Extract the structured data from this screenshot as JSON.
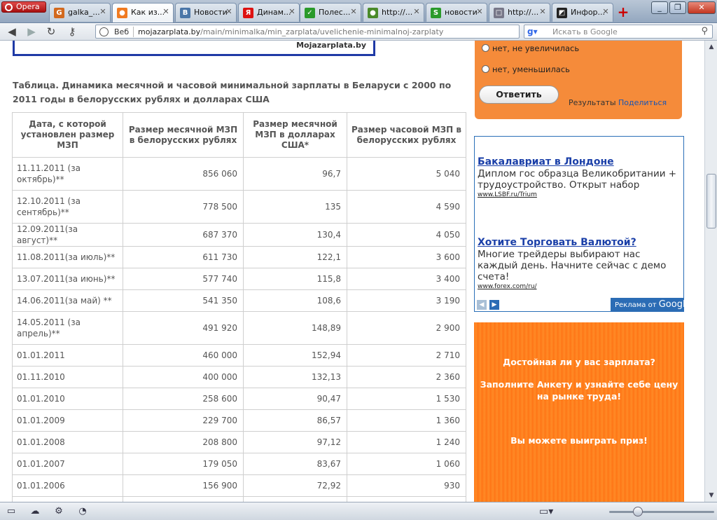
{
  "browser": {
    "menu_label": "Opera",
    "tabs": [
      {
        "label": "galka_...",
        "fav": "G",
        "color": "#d2691e"
      },
      {
        "label": "Как из...",
        "fav": "●",
        "color": "#f07a20",
        "active": true
      },
      {
        "label": "Новости",
        "fav": "B",
        "color": "#4a76a8"
      },
      {
        "label": "Динам...",
        "fav": "Я",
        "color": "#d11"
      },
      {
        "label": "Полес...",
        "fav": "✓",
        "color": "#2a9a2a"
      },
      {
        "label": "http://...",
        "fav": "●",
        "color": "#4a8a2a"
      },
      {
        "label": "новости",
        "fav": "S",
        "color": "#2a9a2a"
      },
      {
        "label": "http://...",
        "fav": "□",
        "color": "#778"
      },
      {
        "label": "Инфор...",
        "fav": "◩",
        "color": "#222"
      }
    ],
    "address": {
      "scheme_label": "Веб",
      "domain": "mojazarplata.by",
      "path": "/main/minimalka/min_zarplata/uvelichenie-minimalnoj-zarplaty"
    },
    "search_placeholder": "Искать в Google"
  },
  "page": {
    "banner_text": "Mojazarplata.by",
    "caption": "Таблица. Динамика месячной и часовой минимальной зарплаты в Беларуси с 2000 по 2011 годы в белорусских рублях и долларах США",
    "table": {
      "headers": [
        "Дата, с которой установлен размер МЗП",
        "Размер месячной МЗП в белорусских рублях",
        "Размер месячной МЗП в долларах США*",
        "Размер часовой МЗП в белорусских рублях"
      ],
      "rows": [
        [
          "11.11.2011 (за октябрь)**",
          "856 060",
          "96,7",
          "5 040"
        ],
        [
          "12.10.2011 (за сентябрь)**",
          "778 500",
          "135",
          "4 590"
        ],
        [
          "12.09.2011(за август)**",
          "687 370",
          "130,4",
          "4 050"
        ],
        [
          "11.08.2011(за июль)**",
          "611 730",
          "122,1",
          "3 600"
        ],
        [
          "13.07.2011(за июнь)**",
          "577 740",
          "115,8",
          "3 400"
        ],
        [
          "14.06.2011(за май) **",
          "541 350",
          "108,6",
          "3 190"
        ],
        [
          "14.05.2011 (за апрель)**",
          "491 920",
          "148,89",
          "2 900"
        ],
        [
          "01.01.2011",
          "460 000",
          "152,94",
          "2 710"
        ],
        [
          "01.11.2010",
          "400 000",
          "132,13",
          "2 360"
        ],
        [
          "01.01.2010",
          "258 600",
          "90,47",
          "1 530"
        ],
        [
          "01.01.2009",
          "229 700",
          "86,57",
          "1 360"
        ],
        [
          "01.01.2008",
          "208 800",
          "97,12",
          "1 240"
        ],
        [
          "01.01.2007",
          "179 050",
          "83,67",
          "1 060"
        ],
        [
          "01.01.2006",
          "156 900",
          "72,92",
          "930"
        ],
        [
          "",
          "",
          "",
          ""
        ]
      ]
    }
  },
  "poll": {
    "options": [
      "нет, не увеличилась",
      "нет, уменьшилась"
    ],
    "answer_label": "Ответить",
    "results_label": "Результаты",
    "share_label": "Поделиться"
  },
  "ads": {
    "items": [
      {
        "title": "Бакалавриат в Лондоне",
        "text": "Диплом гос образца Великобритании + трудоустройство. Открыт набор",
        "url": "www.LSBF.ru/Trium"
      },
      {
        "title": "Хотите Торговать Валютой?",
        "text": "Многие трейдеры выбирают нас каждый день. Начните сейчас с демо счета!",
        "url": "www.forex.com/ru/"
      }
    ],
    "footer_label": "Реклама от",
    "footer_brand": "Google"
  },
  "promo": {
    "line1": "Достойная ли у вас зарплата?",
    "line2": "Заполните Анкету и узнайте себе цену",
    "line3": "на рынке труда!",
    "line4": "Вы можете выиграть приз!"
  }
}
